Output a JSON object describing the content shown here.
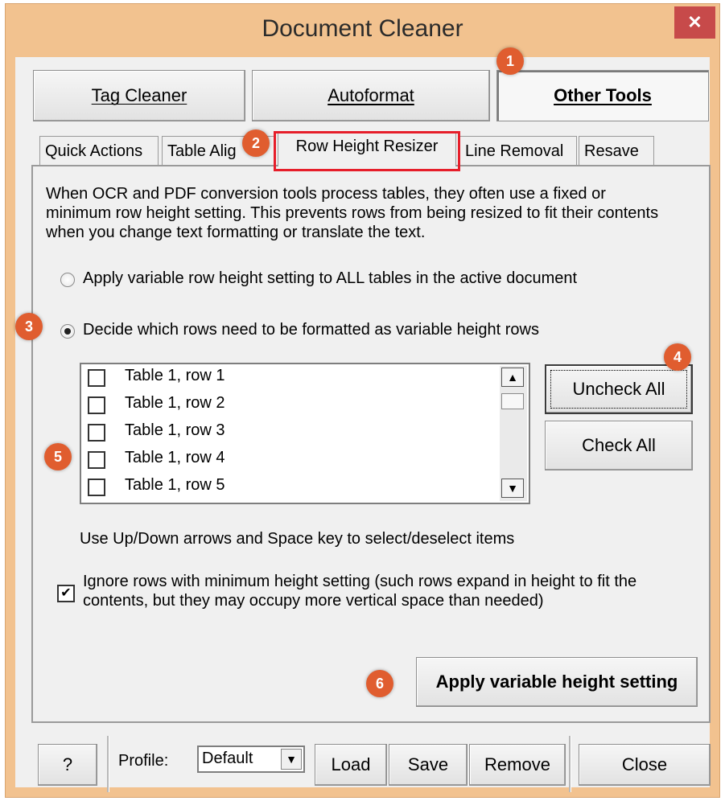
{
  "window": {
    "title": "Document Cleaner",
    "close_glyph": "✕"
  },
  "top_tabs": [
    {
      "label": "Tag Cleaner",
      "mnemonic": "T"
    },
    {
      "label": "Autoformat",
      "mnemonic": "A"
    },
    {
      "label": "Other Tools",
      "mnemonic": "O",
      "active": true
    }
  ],
  "sub_tabs": [
    {
      "label": "Quick Actions"
    },
    {
      "label": "Table Alig"
    },
    {
      "label": "Row Height Resizer",
      "active": true
    },
    {
      "label": "Line Removal"
    },
    {
      "label": "Resave"
    }
  ],
  "panel": {
    "description": "When OCR and PDF conversion tools process tables, they often use a fixed or minimum row height setting. This prevents rows from being resized to fit their contents when you change text formatting or translate the text.",
    "radio_all": {
      "label": "Apply variable row height setting to ALL tables in the active document",
      "selected": false
    },
    "radio_decide": {
      "label": "Decide which rows need to be formatted as variable height rows",
      "selected": true
    },
    "rows": [
      {
        "label": "Table 1, row 1",
        "checked": false
      },
      {
        "label": "Table 1, row 2",
        "checked": false
      },
      {
        "label": "Table 1, row 3",
        "checked": false
      },
      {
        "label": "Table 1, row 4",
        "checked": false
      },
      {
        "label": "Table 1, row 5",
        "checked": false
      }
    ],
    "uncheck_all": "Uncheck All",
    "check_all": "Check All",
    "hint": "Use Up/Down arrows and Space key to select/deselect items",
    "ignore_min": {
      "label": "Ignore rows with minimum height setting (such rows expand in height to fit the contents, but they may occupy more vertical space than needed)",
      "checked": true
    },
    "apply_button": "Apply variable height setting"
  },
  "footer": {
    "help": "?",
    "profile_label": "Profile:",
    "profile_value": "Default",
    "load": "Load",
    "save": "Save",
    "remove": "Remove",
    "close": "Close"
  },
  "callouts": [
    "1",
    "2",
    "3",
    "4",
    "5",
    "6"
  ],
  "colors": {
    "frame": "#f2c28f",
    "close_button": "#c74a4a",
    "badge": "#e05d2f",
    "highlight": "#e61e2a",
    "client": "#f0f0f0"
  }
}
